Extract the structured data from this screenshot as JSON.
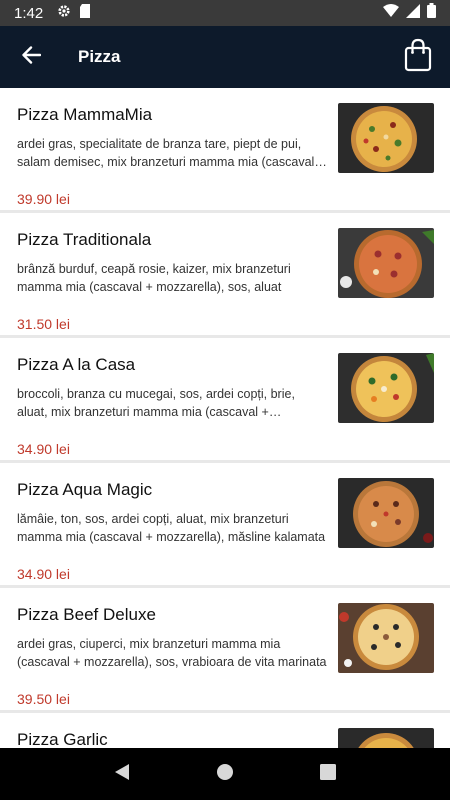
{
  "status_bar": {
    "time": "1:42",
    "icons": [
      "gear-icon",
      "sd-card-icon",
      "wifi-icon",
      "signal-icon",
      "battery-icon"
    ]
  },
  "app_bar": {
    "title": "Pizza",
    "back_icon": "arrow-back-icon",
    "cart_icon": "shopping-bag-icon"
  },
  "products": [
    {
      "name": "Pizza MammaMia",
      "description": "ardei gras, specialitate de branza tare, piept de pui, salam demisec, mix branzeturi mamma mia (cascaval + mozzarella)",
      "price": "39.90 lei"
    },
    {
      "name": "Pizza Traditionala",
      "description": "brânză burduf, ceapă rosie, kaizer, mix branzeturi mamma mia (cascaval + mozzarella), sos, aluat",
      "price": "31.50 lei"
    },
    {
      "name": "Pizza A la Casa",
      "description": "broccoli, branza cu mucegai, sos, ardei copți, brie, aluat, mix branzeturi mamma mia (cascaval + mozzarella)",
      "price": "34.90 lei"
    },
    {
      "name": "Pizza Aqua Magic",
      "description": "lămâie, ton, sos, ardei copți, aluat, mix branzeturi mamma mia (cascaval + mozzarella), măsline kalamata",
      "price": "34.90 lei"
    },
    {
      "name": "Pizza Beef Deluxe",
      "description": "ardei gras, ciuperci, mix branzeturi mamma mia (cascaval + mozzarella), sos, vrabioara de vita marinata",
      "price": "39.50 lei"
    },
    {
      "name": "Pizza Garlic",
      "description": "",
      "price": ""
    }
  ],
  "nav_bar": {
    "icons": [
      "back-triangle-icon",
      "home-circle-icon",
      "recents-square-icon"
    ]
  },
  "colors": {
    "status_bar": "#3a3a3a",
    "app_bar": "#0d1a2b",
    "price": "#c0392b",
    "divider": "#e8e8e8",
    "nav_bar": "#000000"
  }
}
